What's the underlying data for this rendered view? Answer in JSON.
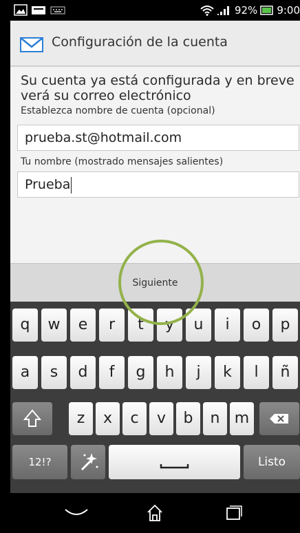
{
  "status_bar": {
    "battery_percent": "92%",
    "time": "9:00"
  },
  "app_bar": {
    "title": "Configuración de la cuenta",
    "icon": "mail-envelope-icon"
  },
  "form": {
    "message": "Su cuenta ya está configurada y en breve verá su correo electrónico",
    "account_name_label": "Establezca nombre de cuenta (opcional)",
    "account_name_value": "prueba.st@hotmail.com",
    "your_name_label": "Tu nombre (mostrado mensajes salientes)",
    "your_name_value": "Prueba"
  },
  "next_button": {
    "label": "Siguiente"
  },
  "keyboard": {
    "row1": [
      "q",
      "w",
      "e",
      "r",
      "t",
      "y",
      "u",
      "i",
      "o",
      "p"
    ],
    "row2": [
      "a",
      "s",
      "d",
      "f",
      "g",
      "h",
      "j",
      "k",
      "l",
      "ñ"
    ],
    "row3": [
      "z",
      "x",
      "c",
      "v",
      "b",
      "n",
      "m"
    ],
    "symbols_label": "12!?",
    "done_label": "Listo"
  },
  "colors": {
    "highlight_circle": "#93b24b",
    "keyboard_bg": "#3d3d3d",
    "mail_icon": "#2a7fd6"
  }
}
